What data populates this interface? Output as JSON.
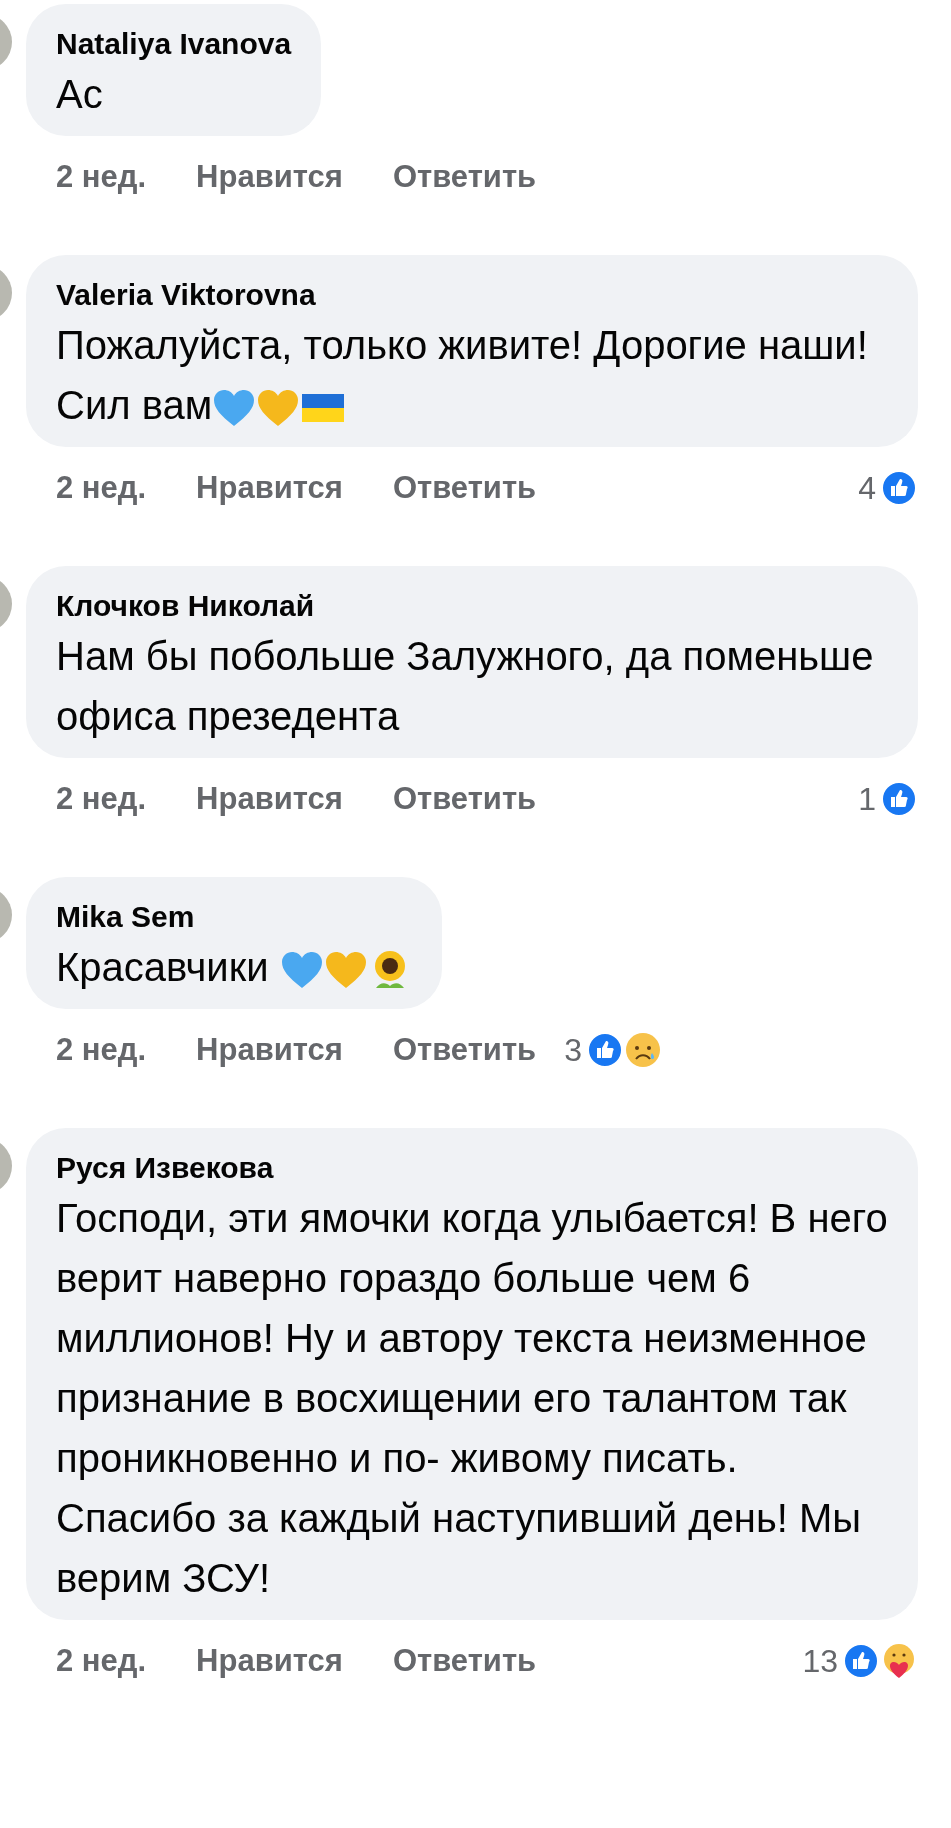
{
  "comments": [
    {
      "author": "Nataliya Ivanova",
      "text": "Ас",
      "time": "2 нед.",
      "like": "Нравится",
      "reply": "Ответить"
    },
    {
      "author": "Valeria Viktorovna",
      "text": "Пожалуйста, только живите! Дорогие наши!Сил вам",
      "emojis": [
        {
          "kind": "heart",
          "color": "#4aa8f0"
        },
        {
          "kind": "heart",
          "color": "#f5b81c"
        },
        {
          "kind": "flag"
        }
      ],
      "time": "2 нед.",
      "like": "Нравится",
      "reply": "Ответить",
      "reactions": {
        "count": "4",
        "icons": [
          {
            "kind": "like"
          }
        ]
      }
    },
    {
      "author": "Клочков Николай",
      "text": "Нам бы побольше  Залужного, да поменьше офиса презедента",
      "time": "2 нед.",
      "like": "Нравится",
      "reply": "Ответить",
      "reactions": {
        "count": "1",
        "icons": [
          {
            "kind": "like"
          }
        ]
      }
    },
    {
      "author": "Mika Sem",
      "text": "Красавчики ",
      "emojis": [
        {
          "kind": "heart",
          "color": "#4aa8f0"
        },
        {
          "kind": "heart",
          "color": "#f5b81c"
        },
        {
          "kind": "sunflower"
        }
      ],
      "time": "2 нед.",
      "like": "Нравится",
      "reply": "Ответить",
      "reactions": {
        "count": "3",
        "icons": [
          {
            "kind": "like"
          },
          {
            "kind": "sad"
          }
        ],
        "inline": true
      }
    },
    {
      "author": "Руся Извекова",
      "text": "Господи, эти ямочки когда улыбается! В него верит наверно гораздо больше чем 6 миллионов! Ну и автору текста неизменное признание в восхищении его талантом так проникновенно и по- живому писать. Спасибо  за каждый наступивший день! Мы верим ЗСУ!",
      "time": "2 нед.",
      "like": "Нравится",
      "reply": "Ответить",
      "reactions": {
        "count": "13",
        "icons": [
          {
            "kind": "like"
          },
          {
            "kind": "care"
          }
        ]
      }
    }
  ]
}
